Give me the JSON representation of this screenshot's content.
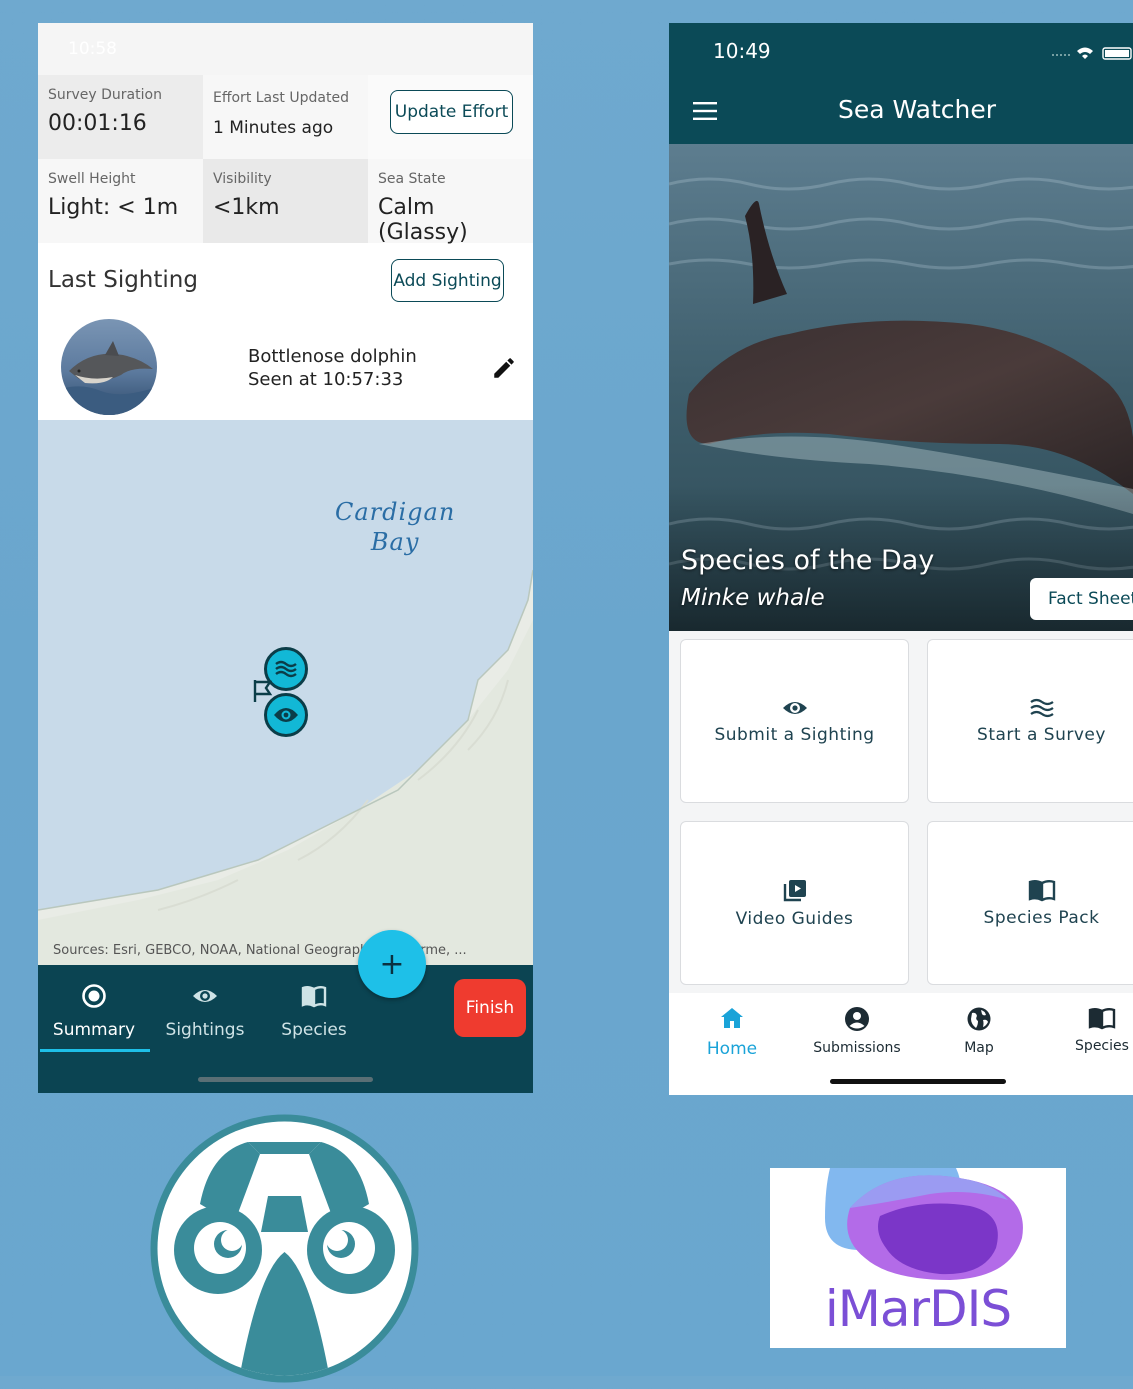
{
  "survey": {
    "status_time": "10:58",
    "survey_duration_label": "Survey Duration",
    "survey_duration_value": "00:01:16",
    "effort_updated_label": "Effort Last Updated",
    "effort_updated_value": "1 Minutes ago",
    "update_effort_label": "Update Effort",
    "swell_label": "Swell Height",
    "swell_value": "Light: < 1m",
    "visibility_label": "Visibility",
    "visibility_value": "<1km",
    "sea_state_label": "Sea State",
    "sea_state_value": "Calm (Glassy)",
    "last_sighting_title": "Last Sighting",
    "add_sighting_label": "Add Sighting",
    "sighting_species": "Bottlenose dolphin",
    "sighting_time": "Seen at 10:57:33",
    "map_label_line1": "Cardigan",
    "map_label_line2": "Bay",
    "map_attribution": "Sources: Esri, GEBCO, NOAA, National Geographic, DeLorme, ...",
    "tabs": [
      {
        "label": "Summary",
        "icon": "radio-target-icon",
        "active": true
      },
      {
        "label": "Sightings",
        "icon": "eye-icon",
        "active": false
      },
      {
        "label": "Species",
        "icon": "book-icon",
        "active": false
      }
    ],
    "fab_symbol": "+",
    "finish_label": "Finish"
  },
  "home": {
    "status_time": "10:49",
    "app_title": "Sea Watcher",
    "species_of_day_title": "Species of the Day",
    "species_of_day_name": "Minke whale",
    "fact_sheet_label": "Fact Sheet",
    "tiles": [
      {
        "label": "Submit a Sighting",
        "icon": "eye-icon"
      },
      {
        "label": "Start a Survey",
        "icon": "waves-icon"
      },
      {
        "label": "Video Guides",
        "icon": "video-library-icon"
      },
      {
        "label": "Species Pack",
        "icon": "book-icon"
      }
    ],
    "tabs": [
      {
        "label": "Home",
        "icon": "home-icon",
        "active": true
      },
      {
        "label": "Submissions",
        "icon": "account-icon",
        "active": false
      },
      {
        "label": "Map",
        "icon": "globe-icon",
        "active": false
      },
      {
        "label": "Species",
        "icon": "book-icon",
        "active": false
      }
    ]
  },
  "logos": {
    "imardis_text": "iMarDIS"
  },
  "colors": {
    "background": "#6aa6cd",
    "teal_dark": "#0b4a57",
    "accent_cyan": "#1ec0e8",
    "finish_red": "#ef3b2f",
    "home_active": "#1aa3d8",
    "imardis_purple": "#7b4fd6"
  }
}
